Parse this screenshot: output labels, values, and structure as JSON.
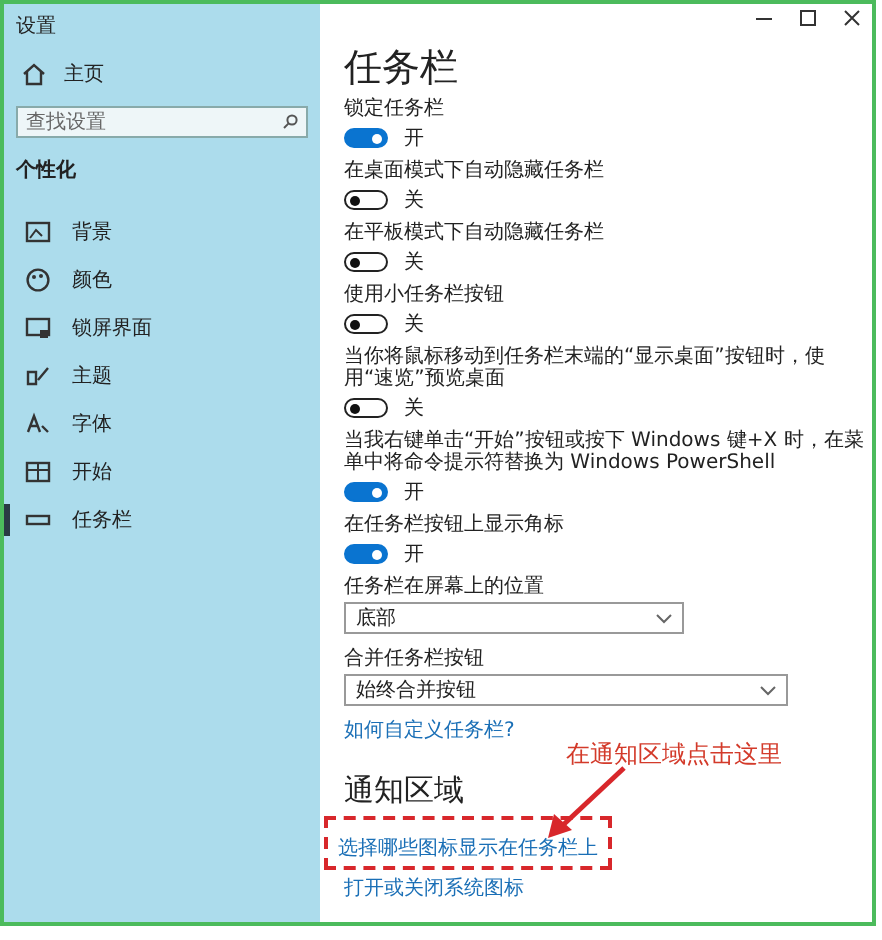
{
  "window": {
    "title": "设置"
  },
  "sidebar": {
    "home": "主页",
    "search": {
      "placeholder": "查找设置"
    },
    "section": "个性化",
    "items": [
      {
        "label": "背景",
        "selected": false
      },
      {
        "label": "颜色",
        "selected": false
      },
      {
        "label": "锁屏界面",
        "selected": false
      },
      {
        "label": "主题",
        "selected": false
      },
      {
        "label": "字体",
        "selected": false
      },
      {
        "label": "开始",
        "selected": false
      },
      {
        "label": "任务栏",
        "selected": true
      }
    ]
  },
  "page": {
    "title": "任务栏",
    "settings": [
      {
        "kind": "toggle",
        "label": "锁定任务栏",
        "on": true,
        "state_text": "开"
      },
      {
        "kind": "toggle",
        "label": "在桌面模式下自动隐藏任务栏",
        "on": false,
        "state_text": "关"
      },
      {
        "kind": "toggle",
        "label": "在平板模式下自动隐藏任务栏",
        "on": false,
        "state_text": "关"
      },
      {
        "kind": "toggle",
        "label": "使用小任务栏按钮",
        "on": false,
        "state_text": "关"
      },
      {
        "kind": "toggle",
        "label": "当你将鼠标移动到任务栏末端的“显示桌面”按钮时，使用“速览”预览桌面",
        "on": false,
        "state_text": "关"
      },
      {
        "kind": "toggle",
        "label": "当我右键单击“开始”按钮或按下 Windows 键+X 时，在菜单中将命令提示符替换为 Windows PowerShell",
        "on": true,
        "state_text": "开"
      },
      {
        "kind": "toggle",
        "label": "在任务栏按钮上显示角标",
        "on": true,
        "state_text": "开"
      },
      {
        "kind": "dropdown",
        "label": "任务栏在屏幕上的位置",
        "value": "底部",
        "wide": false
      },
      {
        "kind": "dropdown",
        "label": "合并任务栏按钮",
        "value": "始终合并按钮",
        "wide": true
      },
      {
        "kind": "link",
        "label": "如何自定义任务栏?"
      }
    ],
    "notification": {
      "title": "通知区域",
      "links": [
        {
          "label": "选择哪些图标显示在任务栏上",
          "highlighted": true
        },
        {
          "label": "打开或关闭系统图标",
          "highlighted": false
        }
      ]
    }
  },
  "annotation": {
    "text": "在通知区域点击这里"
  }
}
